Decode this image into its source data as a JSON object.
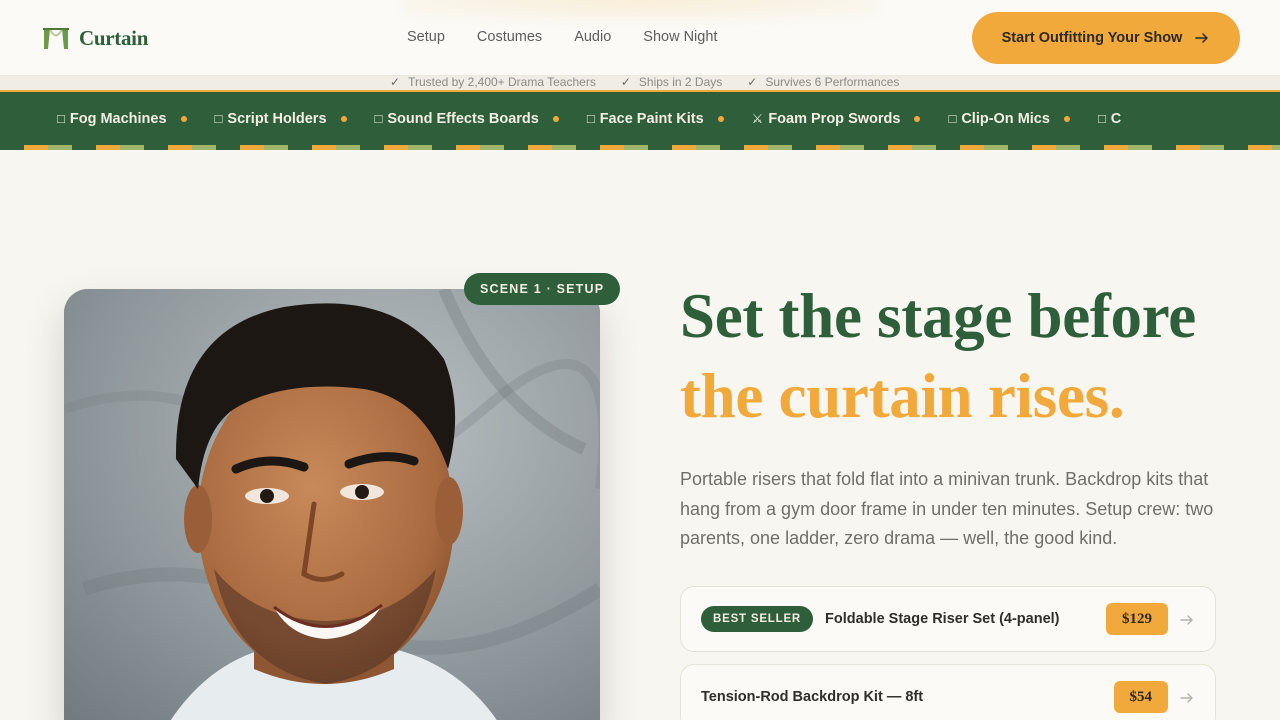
{
  "brand": {
    "name": "Curtain"
  },
  "nav": {
    "items": [
      "Setup",
      "Costumes",
      "Audio",
      "Show Night"
    ]
  },
  "cta": {
    "label": "Start Outfitting Your Show",
    "icon": "arrow-right-icon"
  },
  "trust": {
    "items": [
      "Trusted by 2,400+ Drama Teachers",
      "Ships in 2 Days",
      "Survives 6 Performances"
    ]
  },
  "marquee": {
    "items": [
      {
        "icon": "□",
        "label": "Fog Machines"
      },
      {
        "icon": "□",
        "label": "Script Holders"
      },
      {
        "icon": "□",
        "label": "Sound Effects Boards"
      },
      {
        "icon": "□",
        "label": "Face Paint Kits"
      },
      {
        "icon": "⚔",
        "label": "Foam Prop Swords"
      },
      {
        "icon": "□",
        "label": "Clip-On Mics"
      },
      {
        "icon": "□",
        "label": "C"
      }
    ]
  },
  "hero": {
    "badge": "SCENE 1 · SETUP",
    "headline_line1": "Set the stage before",
    "headline_line2": "the curtain rises.",
    "lede": "Portable risers that fold flat into a minivan trunk. Backdrop kits that hang from a gym door frame in under ten minutes. Setup crew: two parents, one ladder, zero drama — well, the good kind."
  },
  "products": [
    {
      "badge": "BEST SELLER",
      "name": "Foldable Stage Riser Set (4-panel)",
      "price": "$129"
    },
    {
      "badge": "",
      "name": "Tension-Rod Backdrop Kit — 8ft",
      "price": "$54"
    }
  ],
  "colors": {
    "accent_green": "#2e5e3a",
    "accent_orange": "#f2a93b",
    "background": "#f8f6f0"
  }
}
